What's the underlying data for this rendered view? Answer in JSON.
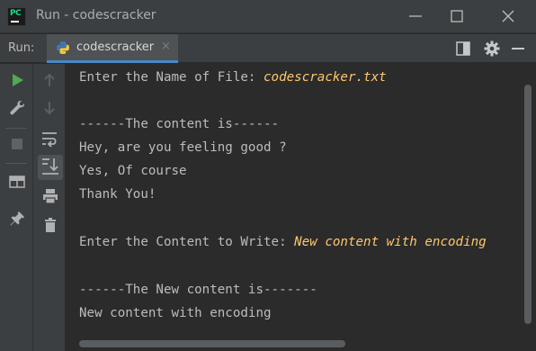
{
  "window": {
    "title": "Run - codescracker",
    "logo_text": "PC"
  },
  "runbar": {
    "label": "Run:",
    "tab_label": "codescracker",
    "tab_close": "×"
  },
  "console": {
    "prompt_filename": "Enter the Name of File: ",
    "input_filename": "codescracker.txt",
    "content_header": "------The content is------",
    "content_lines": [
      "Hey, are you feeling good ?",
      "Yes, Of course",
      "Thank You!"
    ],
    "prompt_content": "Enter the Content to Write: ",
    "input_content": "New content with encoding",
    "new_content_header": "------The New content is-------",
    "new_content_line": "New content with encoding"
  },
  "icons": {
    "rerun": "play-icon",
    "settings": "wrench-icon",
    "stop": "stop-icon",
    "layout": "layout-icon",
    "pin": "pin-icon",
    "up": "arrow-up-icon",
    "down": "arrow-down-icon",
    "softwrap": "soft-wrap-icon",
    "scroll_end": "scroll-to-end-icon",
    "print": "print-icon",
    "trash": "trash-icon"
  },
  "colors": {
    "background": "#2b2b2b",
    "chrome": "#3c3f41",
    "console_text": "#bbbcbd",
    "user_input": "#ffc66d",
    "tab_underline": "#4a88c7",
    "run_green": "#4eaa54"
  }
}
